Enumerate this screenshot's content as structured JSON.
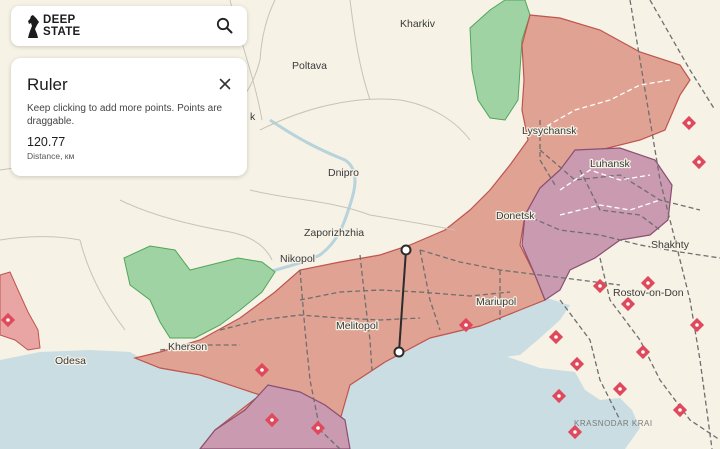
{
  "app": {
    "logo_line1": "DEEP",
    "logo_line2": "STATE"
  },
  "ruler": {
    "title": "Ruler",
    "hint": "Keep clicking to add more points. Points are draggable.",
    "distance": "120.77",
    "distance_label": "Distance, км"
  },
  "map": {
    "cities": {
      "kharkiv": "Kharkiv",
      "poltava": "Poltava",
      "lysychansk": "Lysychansk",
      "luhansk": "Luhansk",
      "dnipro": "Dnipro",
      "donetsk": "Donetsk",
      "zaporizhzhia": "Zaporizhzhia",
      "shakhty": "Shakhty",
      "nikopol": "Nikopol",
      "rostov": "Rostov-on-Don",
      "mariupol": "Mariupol",
      "melitopol": "Melitopol",
      "kherson": "Kherson",
      "odesa": "Odesa",
      "partial": "k"
    },
    "regions": {
      "krasnodar": "KRASNODAR KRAI"
    },
    "colors": {
      "land": "#f6f2e6",
      "sea": "#c9dde3",
      "occupied": "#e0a292",
      "occupied_pre2022": "#c99ab0",
      "liberated": "#9fd3a3",
      "contested": "#e9a4a4",
      "military_marker": "#e0485b"
    },
    "measured_segment": {
      "point_count": 2
    }
  }
}
